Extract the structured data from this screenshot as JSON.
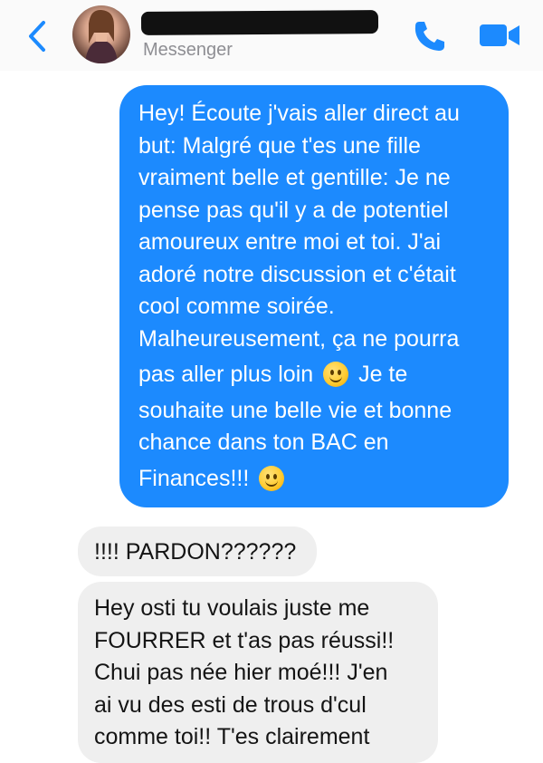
{
  "header": {
    "subtitle": "Messenger",
    "icons": {
      "back": "chevron-left-icon",
      "call": "phone-icon",
      "video": "video-camera-icon"
    },
    "accent_color": "#1c8afe"
  },
  "messages": [
    {
      "direction": "outgoing",
      "lines": [
        "Hey! Écoute j'vais aller direct au",
        "but: Malgré que t'es une fille",
        "vraiment belle et gentille: Je ne",
        "pense pas qu'il y a de potentiel",
        "amoureux entre moi et toi. J'ai",
        "adoré notre discussion et c'était",
        "cool comme soirée.",
        "Malheureusement, ça ne pourra",
        "pas aller plus loin",
        "Je te",
        "souhaite une belle vie et bonne",
        "chance dans ton BAC en",
        "Finances!!!"
      ]
    },
    {
      "direction": "incoming",
      "text": "!!!! PARDON??????"
    },
    {
      "direction": "incoming",
      "lines": [
        "Hey osti tu voulais juste me",
        "FOURRER et t'as pas réussi!!",
        "Chui pas née hier moé!!! J'en",
        "ai vu des esti de trous d'cul",
        "comme toi!! T'es clairement"
      ]
    }
  ]
}
